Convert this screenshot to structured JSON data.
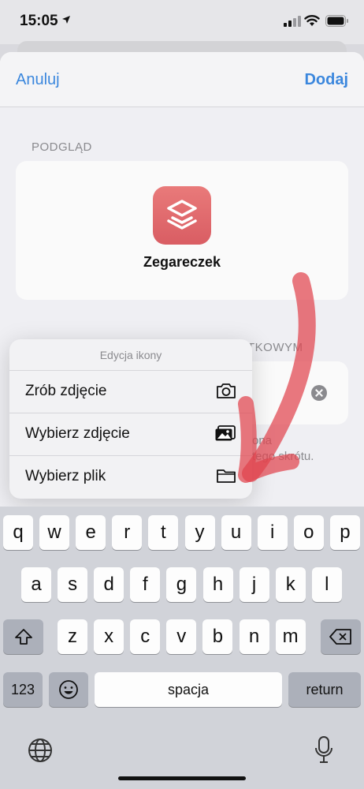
{
  "status_bar": {
    "time": "15:05"
  },
  "navbar": {
    "cancel_label": "Anuluj",
    "add_label": "Dodaj"
  },
  "preview": {
    "section_label": "PODGLĄD",
    "shortcut_name": "Zegareczek",
    "icon_color": "#e06a6e"
  },
  "home_screen_section": {
    "section_label_visible": "TKOWYM",
    "hint_line1": "ona",
    "hint_line2": "tego skrótu."
  },
  "icon_menu": {
    "title": "Edycja ikony",
    "items": [
      {
        "label": "Zrób zdjęcie",
        "icon": "camera-icon"
      },
      {
        "label": "Wybierz zdjęcie",
        "icon": "photos-icon"
      },
      {
        "label": "Wybierz plik",
        "icon": "folder-icon"
      }
    ]
  },
  "keyboard": {
    "row1": [
      "q",
      "w",
      "e",
      "r",
      "t",
      "y",
      "u",
      "i",
      "o",
      "p"
    ],
    "row2": [
      "a",
      "s",
      "d",
      "f",
      "g",
      "h",
      "j",
      "k",
      "l"
    ],
    "row3": [
      "z",
      "x",
      "c",
      "v",
      "b",
      "n",
      "m"
    ],
    "numbers_label": "123",
    "space_label": "spacja",
    "return_label": "return"
  },
  "colors": {
    "accent": "#3b87dd",
    "annotation_arrow": "#e0444e"
  }
}
